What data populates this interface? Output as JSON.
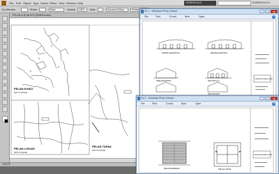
{
  "illustrator": {
    "app_badge": "Ai",
    "menus": [
      "File",
      "Edit",
      "Object",
      "Type",
      "Select",
      "Effect",
      "View",
      "Window",
      "Help"
    ],
    "workspace_switcher": "ESSENTIALS",
    "search_placeholder": "",
    "workspace_label": "ESSENTIALS ▾",
    "control": {
      "selection_label": "No Selection",
      "stroke_label": "Stroke:",
      "stroke_value": "",
      "brush_value": "Basic",
      "opacity_label": "Opacity:",
      "opacity_value": "100%",
      "style_label": "Style:",
      "document_setup": "Document Setup",
      "preferences": "Preferences"
    },
    "document_tab": "PELAN.ai @ 66.67% (RGB/Preview)",
    "status_text": "66.67%",
    "drawing_labels": {
      "site_plan_a_title": "PELAN KUNCI",
      "site_plan_a_scale": "NOT TO SCALE",
      "site_plan_b_title": "PELAN LOKASI",
      "site_plan_b_scale": "NOT TO SCALE",
      "site_plan_c_title": "PELAN TAPAK",
      "site_plan_c_scale": "NOT TO SCALE"
    }
  },
  "viewer_a": {
    "title": "Ss 1 - Windows Photo Viewer",
    "menus": [
      "File",
      "Print",
      "E-mail",
      "Burn",
      "Open"
    ],
    "help": "?",
    "drawing_labels": {
      "elev_front": "FRONT ELEVATION",
      "elev_rear": "REAR ELEVATION",
      "elev_side": "SIDE ELEVATION",
      "section_a": "SECTION A-A",
      "section_b": "SECTION B-B",
      "title_block": "CADANGAN BANGUNAN"
    }
  },
  "viewer_b": {
    "title": "Ss 2 - Windows Photo Viewer",
    "menus": [
      "File",
      "Print",
      "E-mail",
      "Burn",
      "Open"
    ],
    "help": "?",
    "drawing_labels": {
      "plan_left": "PELAN BUMBUNG",
      "plan_right": "PELAN LANTAI",
      "title_block": "CADANGAN BANGUNAN"
    }
  },
  "window_buttons": {
    "minimize": "–",
    "maximize": "□",
    "close": "✕"
  }
}
